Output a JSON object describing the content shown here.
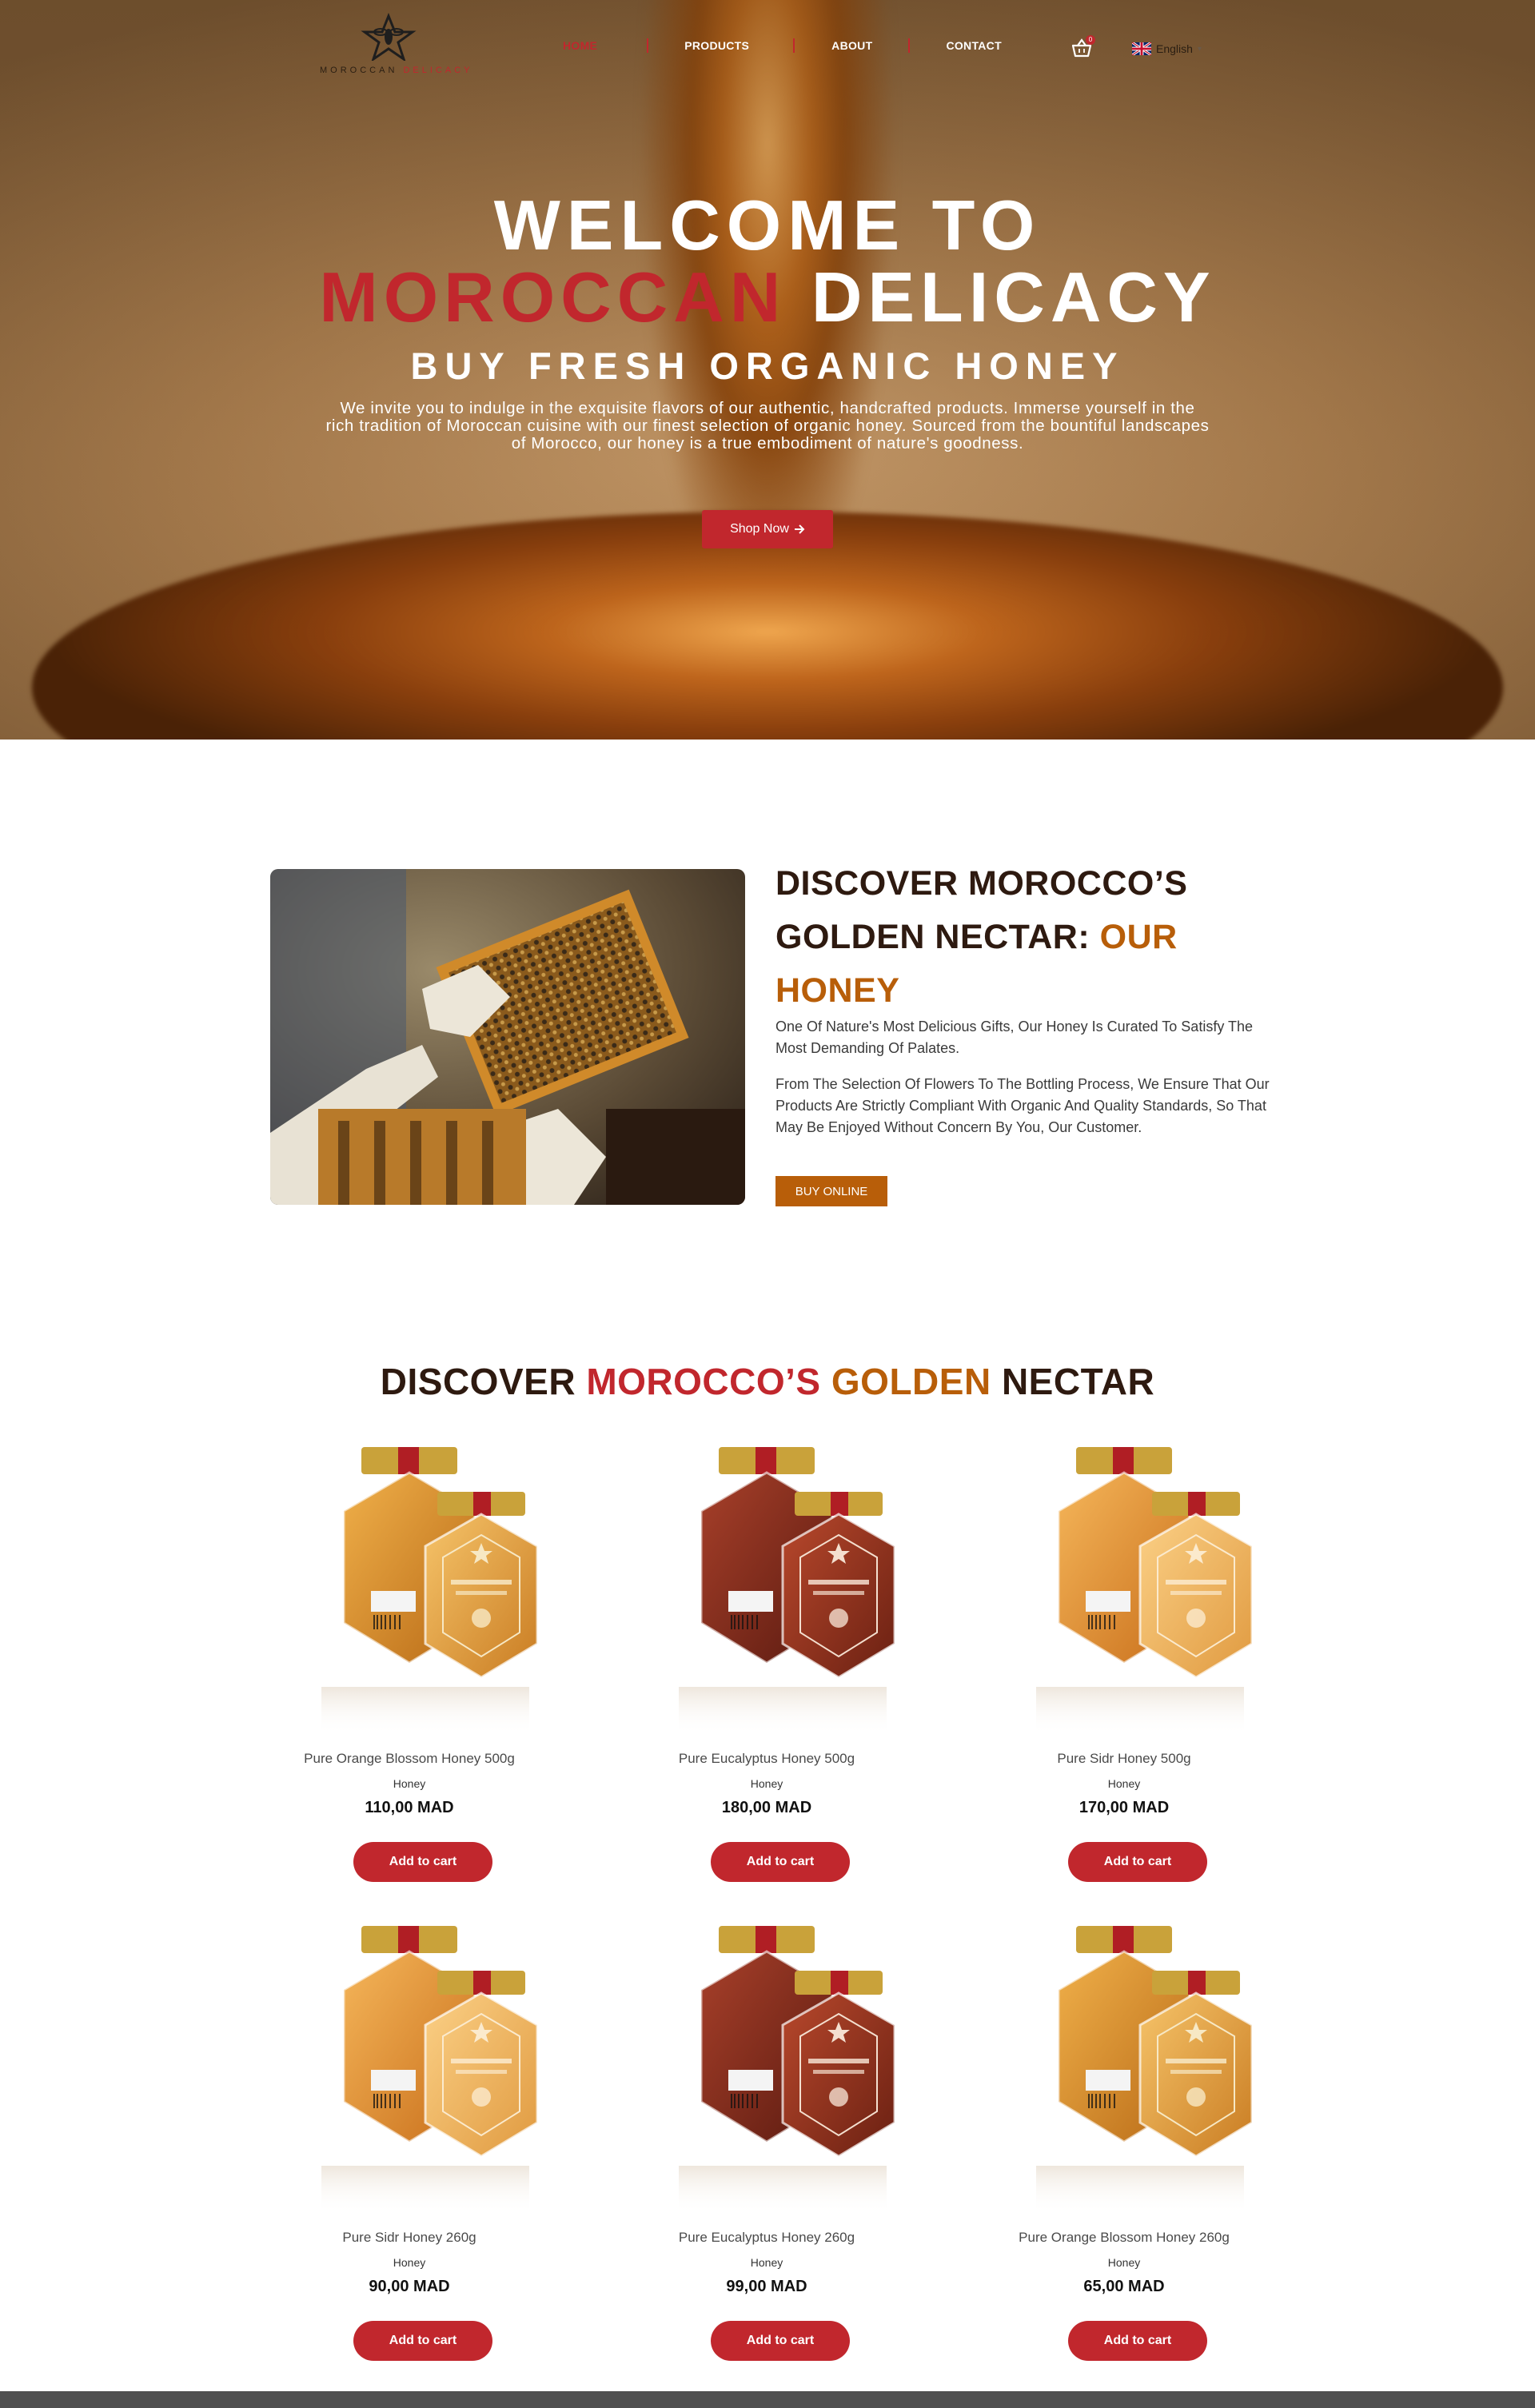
{
  "brand": {
    "logo_text": "MOROCCAN",
    "logo_accent": "DELICACY"
  },
  "nav": {
    "items": [
      {
        "label": "HOME",
        "active": true
      },
      {
        "label": "PRODUCTS",
        "active": false
      },
      {
        "label": "ABOUT",
        "active": false
      },
      {
        "label": "CONTACT",
        "active": false
      }
    ],
    "cart_count": "0",
    "language": "English"
  },
  "hero": {
    "title_line1": "WELCOME TO",
    "title_red": "MOROCCAN",
    "title_white": "DELICACY",
    "subtitle": "BUY FRESH ORGANIC HONEY",
    "description": "We invite you to indulge in the exquisite flavors of our authentic, handcrafted products. Immerse yourself in the rich tradition of Moroccan cuisine with our finest selection of organic honey. Sourced from the bountiful landscapes of Morocco, our honey is a true embodiment of nature's goodness.",
    "cta_label": "Shop Now"
  },
  "about": {
    "title_dark": "DISCOVER MOROCCO’S GOLDEN NECTAR:",
    "title_gold": "OUR HONEY",
    "paragraph1": "One Of Nature's Most Delicious Gifts, Our Honey Is Curated To Satisfy The Most Demanding Of Palates.",
    "paragraph2": "From The Selection Of Flowers To The Bottling Process, We Ensure That Our Products Are Strictly Compliant With Organic And Quality Standards, So That May Be Enjoyed Without Concern By You, Our Customer.",
    "cta_label": "BUY ONLINE"
  },
  "products_section": {
    "title_part1": "DISCOVER",
    "title_part2": "MOROCCO’S",
    "title_part3": "GOLDEN",
    "title_part4": "NECTAR",
    "add_label": "Add to cart",
    "items": [
      {
        "name": "Pure Orange Blossom Honey 500g",
        "category": "Honey",
        "price": "110,00 MAD",
        "variant": "orange"
      },
      {
        "name": "Pure Eucalyptus Honey 500g",
        "category": "Honey",
        "price": "180,00 MAD",
        "variant": "eucalyptus"
      },
      {
        "name": "Pure Sidr Honey 500g",
        "category": "Honey",
        "price": "170,00 MAD",
        "variant": "sidr"
      },
      {
        "name": "Pure Sidr Honey 260g",
        "category": "Honey",
        "price": "90,00 MAD",
        "variant": "sidr"
      },
      {
        "name": "Pure Eucalyptus Honey 260g",
        "category": "Honey",
        "price": "99,00 MAD",
        "variant": "eucalyptus"
      },
      {
        "name": "Pure Orange Blossom Honey 260g",
        "category": "Honey",
        "price": "65,00 MAD",
        "variant": "orange"
      }
    ]
  },
  "colors": {
    "brand_red": "#c1272d",
    "brand_gold": "#b85e09",
    "heading_dark": "#2e1a10"
  }
}
